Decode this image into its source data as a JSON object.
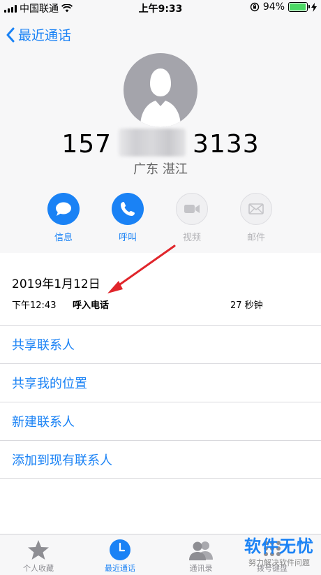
{
  "status_bar": {
    "carrier": "中国联通",
    "time": "上午9:33",
    "battery_percent": "94%",
    "battery_level": 0.94
  },
  "nav": {
    "back_label": "最近通话"
  },
  "contact": {
    "number_prefix": "157",
    "number_suffix": "3133",
    "location": "广东 湛江"
  },
  "actions": [
    {
      "label": "信息",
      "icon": "message-icon",
      "enabled": true
    },
    {
      "label": "呼叫",
      "icon": "phone-icon",
      "enabled": true
    },
    {
      "label": "视频",
      "icon": "video-icon",
      "enabled": false
    },
    {
      "label": "邮件",
      "icon": "mail-icon",
      "enabled": false
    }
  ],
  "call": {
    "date": "2019年1月12日",
    "time": "下午12:43",
    "type": "呼入电话",
    "duration": "27 秒钟"
  },
  "menu": [
    {
      "label": "共享联系人"
    },
    {
      "label": "共享我的位置"
    },
    {
      "label": "新建联系人"
    },
    {
      "label": "添加到现有联系人"
    }
  ],
  "tabbar": [
    {
      "label": "个人收藏",
      "icon": "star-icon",
      "active": false
    },
    {
      "label": "最近通话",
      "icon": "clock-icon",
      "active": true
    },
    {
      "label": "通讯录",
      "icon": "contacts-icon",
      "active": false
    },
    {
      "label": "拨号键盘",
      "icon": "keypad-icon",
      "active": false
    }
  ],
  "watermark": {
    "main": "软件无忧",
    "sub": "努力解决软件问题"
  },
  "colors": {
    "accent": "#1a82f5",
    "annotation_arrow": "#e0252b",
    "battery": "#4cd964"
  }
}
